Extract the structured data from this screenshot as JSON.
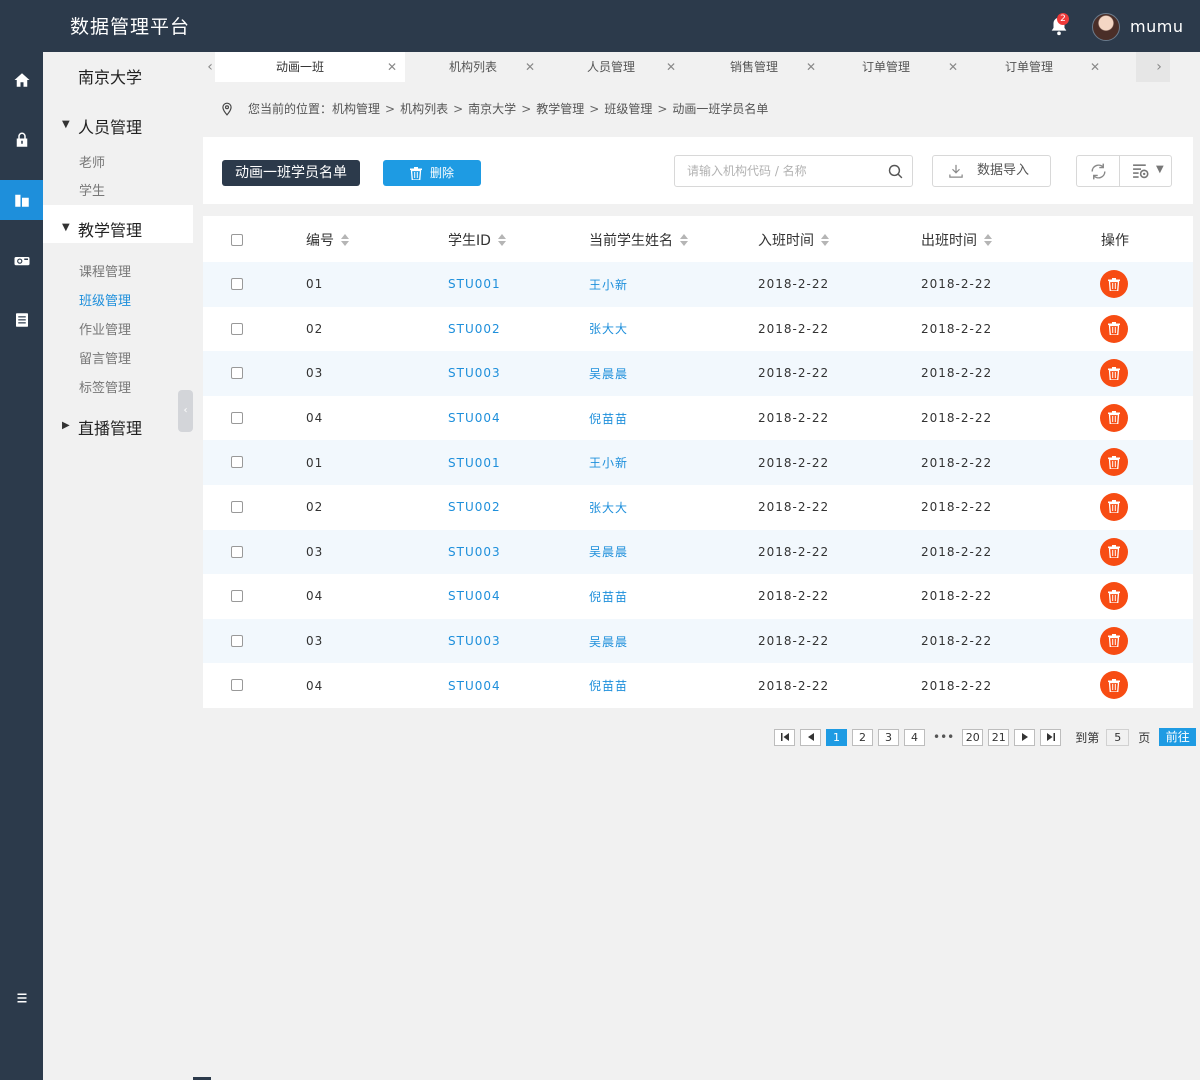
{
  "header": {
    "app_title": "数据管理平台",
    "notification_count": "2",
    "username": "mumu"
  },
  "rail": {
    "items": [
      "home-icon",
      "lock-icon",
      "building-icon",
      "camera-icon",
      "list-icon"
    ],
    "active_index": 2,
    "bottom_icon": "menu-icon"
  },
  "sidebar": {
    "org_name": "南京大学",
    "groups": [
      {
        "title": "人员管理",
        "expanded": true,
        "items": [
          "老师",
          "学生"
        ]
      },
      {
        "title": "教学管理",
        "expanded": true,
        "items": [
          "课程管理",
          "班级管理",
          "作业管理",
          "留言管理",
          "标签管理"
        ],
        "active_item": "班级管理"
      },
      {
        "title": "直播管理",
        "expanded": false,
        "items": []
      }
    ]
  },
  "tabs": [
    {
      "label": "动画一班",
      "active": true
    },
    {
      "label": "机构列表",
      "active": false
    },
    {
      "label": "人员管理",
      "active": false
    },
    {
      "label": "销售管理",
      "active": false
    },
    {
      "label": "订单管理",
      "active": false
    },
    {
      "label": "订单管理",
      "active": false
    }
  ],
  "breadcrumb": {
    "prefix": "您当前的位置：",
    "items": [
      "机构管理",
      "机构列表",
      "南京大学",
      "教学管理",
      "班级管理",
      "动画一班学员名单"
    ],
    "separator": ">"
  },
  "toolbar": {
    "title": "动画一班学员名单",
    "delete_label": "删除",
    "search_placeholder": "请输入机构代码 / 名称",
    "import_label": "数据导入"
  },
  "table": {
    "columns": [
      "编号",
      "学生ID",
      "当前学生姓名",
      "入班时间",
      "出班时间",
      "操作"
    ],
    "rows": [
      {
        "no": "01",
        "id": "STU001",
        "name": "王小新",
        "in": "2018-2-22",
        "out": "2018-2-22"
      },
      {
        "no": "02",
        "id": "STU002",
        "name": "张大大",
        "in": "2018-2-22",
        "out": "2018-2-22"
      },
      {
        "no": "03",
        "id": "STU003",
        "name": "吴晨晨",
        "in": "2018-2-22",
        "out": "2018-2-22"
      },
      {
        "no": "04",
        "id": "STU004",
        "name": "倪苗苗",
        "in": "2018-2-22",
        "out": "2018-2-22"
      },
      {
        "no": "01",
        "id": "STU001",
        "name": "王小新",
        "in": "2018-2-22",
        "out": "2018-2-22"
      },
      {
        "no": "02",
        "id": "STU002",
        "name": "张大大",
        "in": "2018-2-22",
        "out": "2018-2-22"
      },
      {
        "no": "03",
        "id": "STU003",
        "name": "吴晨晨",
        "in": "2018-2-22",
        "out": "2018-2-22"
      },
      {
        "no": "04",
        "id": "STU004",
        "name": "倪苗苗",
        "in": "2018-2-22",
        "out": "2018-2-22"
      },
      {
        "no": "03",
        "id": "STU003",
        "name": "吴晨晨",
        "in": "2018-2-22",
        "out": "2018-2-22"
      },
      {
        "no": "04",
        "id": "STU004",
        "name": "倪苗苗",
        "in": "2018-2-22",
        "out": "2018-2-22"
      }
    ]
  },
  "pagination": {
    "pages": [
      "1",
      "2",
      "3",
      "4"
    ],
    "ellipsis": "•••",
    "last_pages": [
      "20",
      "21"
    ],
    "current": "1",
    "goto_prefix": "到第",
    "goto_value": "5",
    "goto_suffix": "页",
    "goto_button": "前往"
  },
  "colors": {
    "primary_dark": "#2c3a4b",
    "accent_blue": "#1e9be3",
    "danger_orange": "#f74c13"
  }
}
